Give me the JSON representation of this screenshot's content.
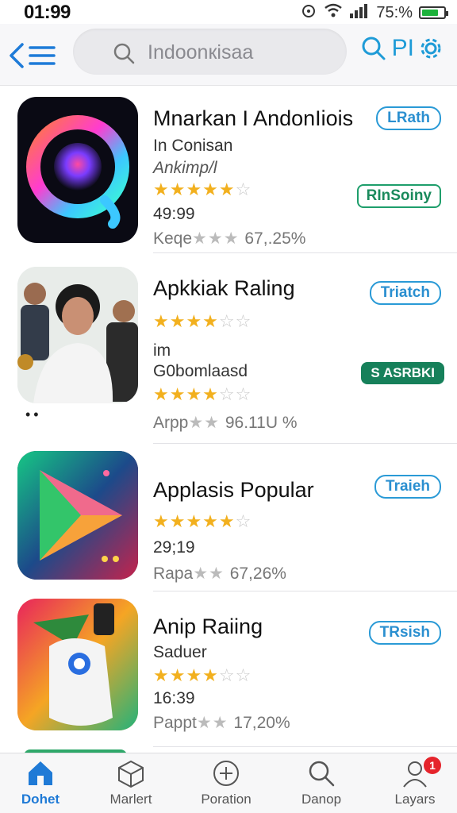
{
  "status": {
    "time": "01:99",
    "battery": "75:%",
    "battery_level": 0.75
  },
  "header": {
    "search_placeholder": "Indoonкisaa",
    "right_label": "PI",
    "accent": "#1e7bd8"
  },
  "apps": [
    {
      "title": "Mnarkan I AndonIiois",
      "line1": "In Conisan",
      "line2": "Ankimp/l",
      "stars": 5,
      "line3": "49:99",
      "metric_prefix": "Keqe",
      "metric_value": "67,.25%",
      "button": "LRath",
      "button2": "RInSoiny"
    },
    {
      "title": "Apkkiak Raling",
      "stars_a": 4,
      "line1": "im",
      "line2": "G0bomlaasd",
      "stars_b": 4,
      "metric_prefix": "Arpp",
      "metric_value": "96.11U %",
      "button": "Triatch",
      "button2": "S ASRBKI"
    },
    {
      "title": "Applasis Popular",
      "stars": 5,
      "line1": "29;19",
      "metric_prefix": "Rapa",
      "metric_value": "67,26%",
      "button": "Traieh"
    },
    {
      "title": "Anip Raiing",
      "line1": "Saduer",
      "stars": 4,
      "line2": "16:39",
      "metric_prefix": "Pappt",
      "metric_value": "17,20%",
      "button": "TRsish"
    }
  ],
  "tabs": [
    {
      "label": "Dohet",
      "icon": "home-icon",
      "active": true
    },
    {
      "label": "Marlert",
      "icon": "cube-icon"
    },
    {
      "label": "Poration",
      "icon": "plus-circle-icon"
    },
    {
      "label": "Danop",
      "icon": "search-icon"
    },
    {
      "label": "Layars",
      "icon": "profile-icon",
      "badge": "1"
    }
  ],
  "colors": {
    "accent": "#1e7bd8",
    "star": "#f2b01e",
    "green": "#16805a",
    "badge": "#e5242c"
  }
}
